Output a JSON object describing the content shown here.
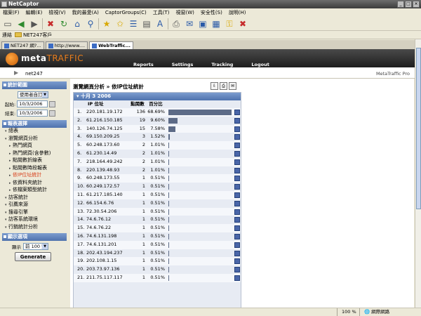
{
  "window": {
    "title": "NetCaptor"
  },
  "menu": [
    "檔案(F)",
    "編輯(E)",
    "檢視(V)",
    "我的最愛(A)",
    "CaptorGroups(C)",
    "工具(T)",
    "視窗(W)",
    "安全性(S)",
    "說明(H)"
  ],
  "links": {
    "label": "連結",
    "item": "NET247客戶"
  },
  "tabs": [
    "NET247 網?...",
    "http://www....",
    "WebTraffic..."
  ],
  "app": {
    "logo_main": "meta",
    "logo_accent": "TRAFFIC",
    "nav": [
      "Reports",
      "Settings",
      "Tracking",
      "Logout"
    ],
    "account": "net247",
    "product": "MetaTraffic Pro"
  },
  "sidebar": {
    "stats_title": "統計範圍",
    "range_select": "使用者自訂",
    "start_label": "起始:",
    "start_date": "10/3/2006",
    "end_label": "結束:",
    "end_date": "10/3/2006",
    "report_title": "報表選擇",
    "nav": [
      {
        "label": "總表",
        "level": 1,
        "current": false
      },
      {
        "label": "瀏覽網頁分析",
        "level": 1,
        "current": false
      },
      {
        "label": "熱門網頁",
        "level": 2,
        "current": false
      },
      {
        "label": "熱門網頁(含參數)",
        "level": 2,
        "current": false
      },
      {
        "label": "點閱數折線表",
        "level": 2,
        "current": false
      },
      {
        "label": "點閱數時段報表",
        "level": 2,
        "current": false
      },
      {
        "label": "依IP位址統計",
        "level": 2,
        "current": true
      },
      {
        "label": "依資料夾統計",
        "level": 2,
        "current": false
      },
      {
        "label": "依檔案類型統計",
        "level": 2,
        "current": false
      },
      {
        "label": "訪客統計",
        "level": 1,
        "current": false
      },
      {
        "label": "引薦來源",
        "level": 1,
        "current": false
      },
      {
        "label": "搜尋引擎",
        "level": 1,
        "current": false
      },
      {
        "label": "訪客系統環境",
        "level": 1,
        "current": false
      },
      {
        "label": "行銷統計分析",
        "level": 1,
        "current": false
      }
    ],
    "display_title": "顯示選項",
    "display_label": "顯示",
    "display_select": "前 100 筆",
    "generate_label": "Generate"
  },
  "report": {
    "title": "瀏覽網頁分析 » 依IP位址統計",
    "date": "十月 3 2006",
    "headers": {
      "ip": "IP 位址",
      "hits": "點閱數",
      "pct": "百分比"
    },
    "rows": [
      {
        "n": "1.",
        "ip": "220.181.19.172",
        "hits": "136",
        "pct": "68.69%"
      },
      {
        "n": "2.",
        "ip": "61.216.150.185",
        "hits": "19",
        "pct": "9.60%"
      },
      {
        "n": "3.",
        "ip": "140.126.74.125",
        "hits": "15",
        "pct": "7.58%"
      },
      {
        "n": "4.",
        "ip": "69.150.209.25",
        "hits": "3",
        "pct": "1.52%"
      },
      {
        "n": "5.",
        "ip": "60.248.173.60",
        "hits": "2",
        "pct": "1.01%"
      },
      {
        "n": "6.",
        "ip": "61.230.14.49",
        "hits": "2",
        "pct": "1.01%"
      },
      {
        "n": "7.",
        "ip": "218.164.49.242",
        "hits": "2",
        "pct": "1.01%"
      },
      {
        "n": "8.",
        "ip": "220.139.48.93",
        "hits": "2",
        "pct": "1.01%"
      },
      {
        "n": "9.",
        "ip": "60.248.173.55",
        "hits": "1",
        "pct": "0.51%"
      },
      {
        "n": "10.",
        "ip": "60.249.172.57",
        "hits": "1",
        "pct": "0.51%"
      },
      {
        "n": "11.",
        "ip": "61.217.185.140",
        "hits": "1",
        "pct": "0.51%"
      },
      {
        "n": "12.",
        "ip": "66.154.6.76",
        "hits": "1",
        "pct": "0.51%"
      },
      {
        "n": "13.",
        "ip": "72.30.54.206",
        "hits": "1",
        "pct": "0.51%"
      },
      {
        "n": "14.",
        "ip": "74.6.76.12",
        "hits": "1",
        "pct": "0.51%"
      },
      {
        "n": "15.",
        "ip": "74.6.76.22",
        "hits": "1",
        "pct": "0.51%"
      },
      {
        "n": "16.",
        "ip": "74.6.131.198",
        "hits": "1",
        "pct": "0.51%"
      },
      {
        "n": "17.",
        "ip": "74.6.131.201",
        "hits": "1",
        "pct": "0.51%"
      },
      {
        "n": "18.",
        "ip": "202.43.194.237",
        "hits": "1",
        "pct": "0.51%"
      },
      {
        "n": "19.",
        "ip": "202.108.1.15",
        "hits": "1",
        "pct": "0.51%"
      },
      {
        "n": "20.",
        "ip": "203.73.97.136",
        "hits": "1",
        "pct": "0.51%"
      },
      {
        "n": "21.",
        "ip": "211.75.117.117",
        "hits": "1",
        "pct": "0.51%"
      }
    ]
  },
  "status": {
    "zoom": "100 %",
    "zone": "網際網路"
  }
}
